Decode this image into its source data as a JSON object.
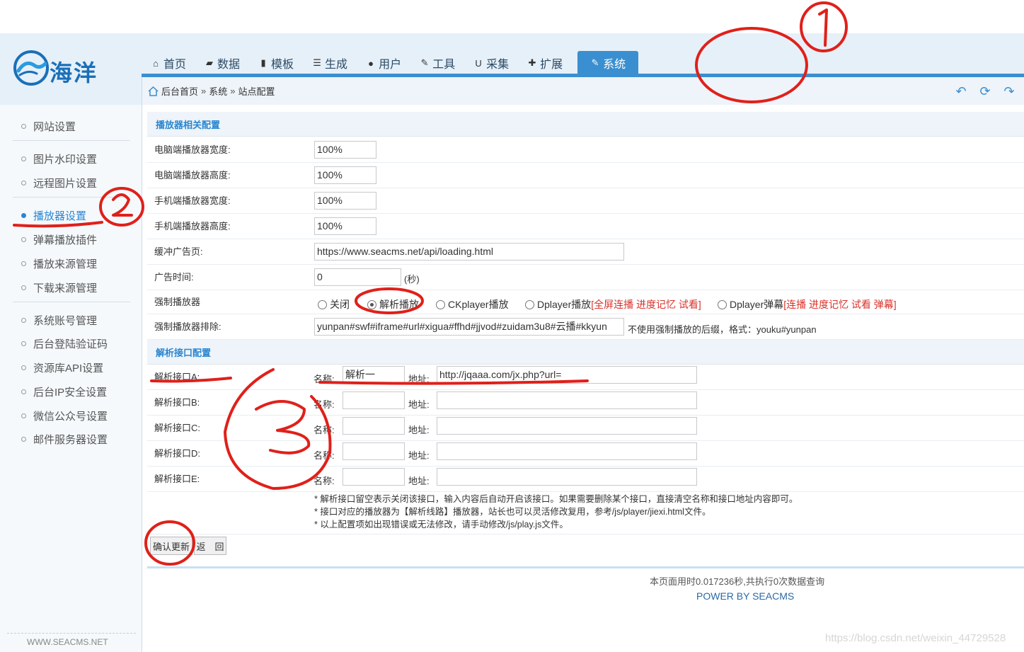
{
  "brand": {
    "logo_text": "海洋"
  },
  "nav": [
    {
      "label": "首页",
      "icon": "home-icon",
      "glyph": "⌂"
    },
    {
      "label": "数据",
      "icon": "database-icon",
      "glyph": "▰"
    },
    {
      "label": "模板",
      "icon": "file-icon",
      "glyph": "▮"
    },
    {
      "label": "生成",
      "icon": "list-icon",
      "glyph": "☰"
    },
    {
      "label": "用户",
      "icon": "user-icon",
      "glyph": "●"
    },
    {
      "label": "工具",
      "icon": "wrench-icon",
      "glyph": "✎"
    },
    {
      "label": "采集",
      "icon": "magnet-icon",
      "glyph": "U"
    },
    {
      "label": "扩展",
      "icon": "puzzle-icon",
      "glyph": "✚"
    },
    {
      "label": "系统",
      "icon": "edit-icon",
      "glyph": "✎",
      "active": true
    }
  ],
  "breadcrumb": {
    "home": "后台首页",
    "sep": "»",
    "level1": "系统",
    "level2": "站点配置"
  },
  "toolbar": {
    "back_icon": "back-arrow-icon",
    "refresh_icon": "refresh-icon",
    "forward_icon": "forward-arrow-icon"
  },
  "sidebar": {
    "items": [
      {
        "label": "网站设置"
      },
      {
        "label": "图片水印设置"
      },
      {
        "label": "远程图片设置"
      },
      {
        "label": "播放器设置",
        "active": true
      },
      {
        "label": "弹幕播放插件"
      },
      {
        "label": "播放来源管理"
      },
      {
        "label": "下载来源管理"
      },
      {
        "label": "系统账号管理"
      },
      {
        "label": "后台登陆验证码"
      },
      {
        "label": "资源库API设置"
      },
      {
        "label": "后台IP安全设置"
      },
      {
        "label": "微信公众号设置"
      },
      {
        "label": "邮件服务器设置"
      }
    ],
    "footer": "WWW.SEACMS.NET"
  },
  "player": {
    "section_title": "播放器相关配置",
    "pc_width": {
      "label": "电脑端播放器宽度:",
      "value": "100%"
    },
    "pc_height": {
      "label": "电脑端播放器高度:",
      "value": "100%"
    },
    "m_width": {
      "label": "手机端播放器宽度:",
      "value": "100%"
    },
    "m_height": {
      "label": "手机端播放器高度:",
      "value": "100%"
    },
    "buffer_ad": {
      "label": "缓冲广告页:",
      "value": "https://www.seacms.net/api/loading.html"
    },
    "ad_time": {
      "label": "广告时间:",
      "value": "0",
      "unit": "(秒)"
    },
    "force": {
      "label": "强制播放器",
      "options": [
        {
          "label": "关闭",
          "checked": false
        },
        {
          "label": "解析播放",
          "checked": true
        },
        {
          "label": "CKplayer播放",
          "checked": false
        },
        {
          "label": "Dplayer播放",
          "extra": "[全屏连播 进度记忆 试看]",
          "checked": false
        },
        {
          "label": "Dplayer弹幕",
          "extra": "[连播 进度记忆 试看 弹幕]",
          "checked": false
        }
      ]
    },
    "exclude": {
      "label": "强制播放器排除:",
      "value": "yunpan#swf#iframe#url#xigua#ffhd#jjvod#zuidam3u8#云播#kkyun",
      "hint": "不使用强制播放的后缀，格式：youku#yunpan"
    }
  },
  "parse": {
    "section_title": "解析接口配置",
    "name_label": "名称:",
    "addr_label": "地址:",
    "rows": [
      {
        "label": "解析接口A:",
        "name": "解析一",
        "addr": "http://jqaaa.com/jx.php?url="
      },
      {
        "label": "解析接口B:",
        "name": "",
        "addr": ""
      },
      {
        "label": "解析接口C:",
        "name": "",
        "addr": ""
      },
      {
        "label": "解析接口D:",
        "name": "",
        "addr": ""
      },
      {
        "label": "解析接口E:",
        "name": "",
        "addr": ""
      }
    ],
    "notes": [
      "* 解析接口留空表示关闭该接口，输入内容后自动开启该接口。如果需要删除某个接口，直接清空名称和接口地址内容即可。",
      "* 接口对应的播放器为【解析线路】播放器，站长也可以灵活修改复用，参考/js/player/jiexi.html文件。",
      "* 以上配置项如出现错误或无法修改，请手动修改/js/play.js文件。"
    ]
  },
  "buttons": {
    "submit": "确认更新",
    "back": "返　回"
  },
  "footer": {
    "stats": "本页面用时0.017236秒,共执行0次数据查询",
    "powered": "POWER BY SEACMS"
  },
  "watermark": "https://blog.csdn.net/weixin_44729528",
  "annotations": {
    "mark1": "①",
    "mark2": "②",
    "mark3": "③",
    "color": "#e0201a"
  }
}
